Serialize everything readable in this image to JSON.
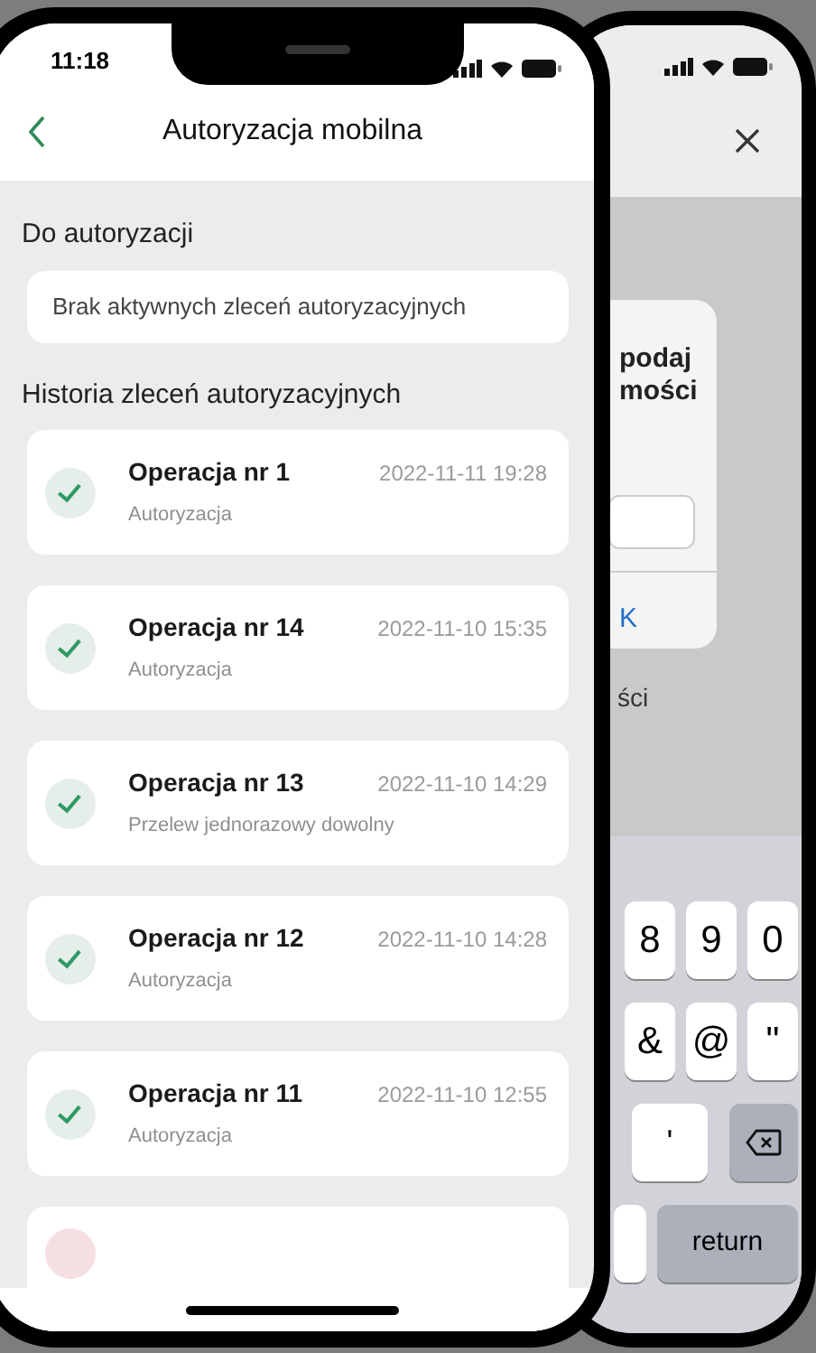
{
  "front_phone": {
    "status_bar": {
      "time": "11:18"
    },
    "header": {
      "title": "Autoryzacja mobilna"
    },
    "pending": {
      "heading": "Do autoryzacji",
      "empty_message": "Brak aktywnych zleceń autoryzacyjnych"
    },
    "history": {
      "heading": "Historia zleceń autoryzacyjnych",
      "items": [
        {
          "title": "Operacja nr 1",
          "date": "2022-11-11 19:28",
          "subtitle": "Autoryzacja",
          "authorized": true
        },
        {
          "title": "Operacja nr 14",
          "date": "2022-11-10 15:35",
          "subtitle": "Autoryzacja",
          "authorized": true
        },
        {
          "title": "Operacja nr 13",
          "date": "2022-11-10 14:29",
          "subtitle": "Przelew jednorazowy dowolny",
          "authorized": true
        },
        {
          "title": "Operacja nr 12",
          "date": "2022-11-10 14:28",
          "subtitle": "Autoryzacja",
          "authorized": true
        },
        {
          "title": "Operacja nr 11",
          "date": "2022-11-10 12:55",
          "subtitle": "Autoryzacja",
          "authorized": true
        },
        {
          "authorized": false
        }
      ]
    }
  },
  "back_phone": {
    "dialog": {
      "text_lines": [
        "podaj",
        "mości"
      ],
      "button": "K"
    },
    "caption": "ści",
    "keyboard": {
      "rows": [
        [
          {
            "kind": "char",
            "label": "8"
          },
          {
            "kind": "char",
            "label": "9"
          },
          {
            "kind": "char",
            "label": "0"
          }
        ],
        [
          {
            "kind": "char",
            "label": "&"
          },
          {
            "kind": "char",
            "label": "@"
          },
          {
            "kind": "char",
            "label": "\""
          }
        ],
        [
          {
            "kind": "wide",
            "label": "'"
          },
          {
            "kind": "backspace"
          }
        ],
        [
          {
            "kind": "space"
          },
          {
            "kind": "return",
            "label": "return"
          }
        ]
      ]
    }
  }
}
